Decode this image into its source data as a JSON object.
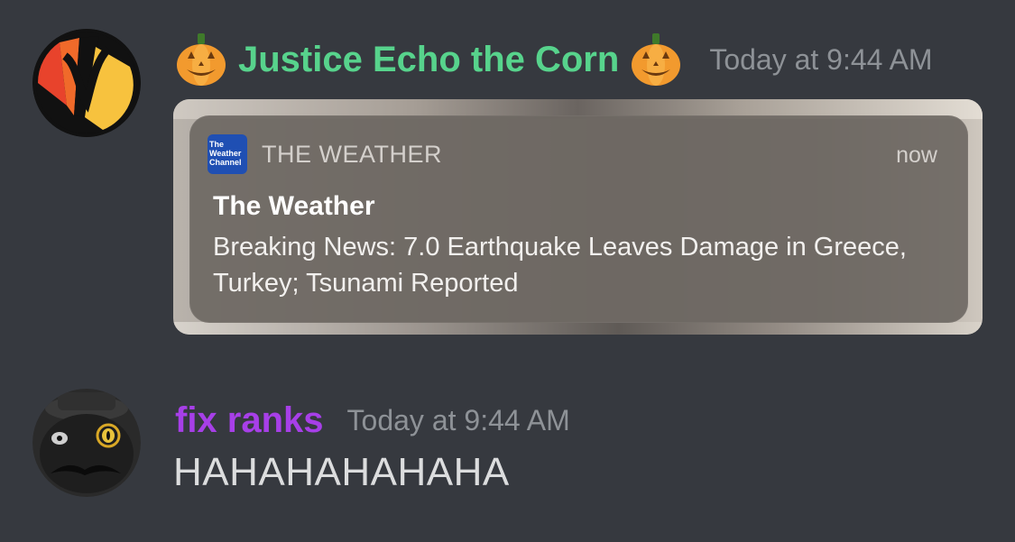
{
  "messages": [
    {
      "avatar_icon": "stylized-v-logo-avatar",
      "username": "Justice Echo the Corn",
      "username_color": "#57d38c",
      "decoration_icon": "jack-o-lantern-icon",
      "timestamp": "Today at 9:44 AM",
      "embed": {
        "app_icon_text": "The Weather Channel",
        "app_name": "THE WEATHER",
        "time": "now",
        "title": "The Weather",
        "body": "Breaking News: 7.0 Earthquake Leaves Damage in Greece, Turkey; Tsunami Reported"
      }
    },
    {
      "avatar_icon": "cat-with-monocle-avatar",
      "username": "fix ranks",
      "username_color": "#a73fe8",
      "timestamp": "Today at 9:44 AM",
      "content": "HAHAHAHAHAHA"
    }
  ],
  "colors": {
    "background": "#36393f",
    "timestamp": "#8e9297",
    "text": "#dcddde"
  }
}
